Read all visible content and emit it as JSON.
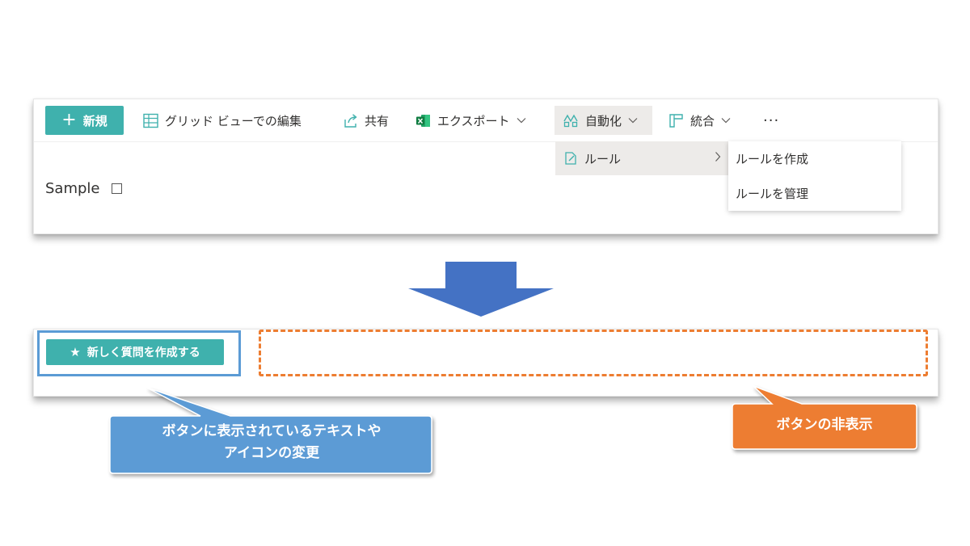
{
  "toolbar": {
    "new_label": "新規",
    "grid_label": "グリッド ビューでの編集",
    "share_label": "共有",
    "export_label": "エクスポート",
    "automate_label": "自動化",
    "integrate_label": "統合",
    "more_label": "···"
  },
  "menu": {
    "rules_label": "ルール",
    "submenu": [
      "ルールを作成",
      "ルールを管理"
    ]
  },
  "list": {
    "title": "Sample"
  },
  "after": {
    "button_label": "新しく質問を作成する"
  },
  "callouts": {
    "blue_line1": "ボタンに表示されているテキストや",
    "blue_line2": "アイコンの変更",
    "orange": "ボタンの非表示"
  },
  "colors": {
    "accent": "#3fb1ad",
    "arrow": "#4472c4",
    "callout_blue": "#5b9bd5",
    "callout_orange": "#ed7d31"
  }
}
